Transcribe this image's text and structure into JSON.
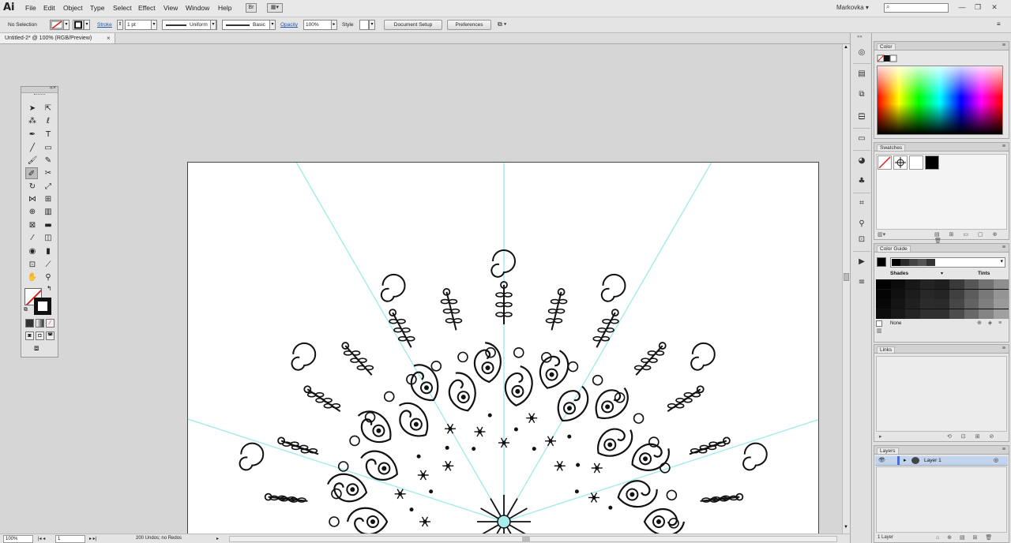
{
  "app": {
    "logo": "Ai"
  },
  "menu": [
    "File",
    "Edit",
    "Object",
    "Type",
    "Select",
    "Effect",
    "View",
    "Window",
    "Help"
  ],
  "workspace": "Markovka",
  "control_bar": {
    "selection": "No Selection",
    "stroke_label": "Stroke",
    "stroke_weight": "1 pt",
    "profile": "Uniform",
    "brush": "Basic",
    "opacity_label": "Opacity",
    "opacity_value": "100%",
    "style_label": "Style",
    "document_setup": "Document Setup",
    "preferences": "Preferences"
  },
  "document_tab": {
    "title": "Untitled-2* @ 100% (RGB/Preview)",
    "close": "×"
  },
  "status_bar": {
    "zoom": "100%",
    "artboard": "1",
    "status": "200 Undos; no Redos"
  },
  "panels": {
    "color": {
      "title": "Color"
    },
    "swatches": {
      "title": "Swatches"
    },
    "color_guide": {
      "title": "Color Guide",
      "shades": "Shades",
      "tints": "Tints",
      "none": "None"
    },
    "links": {
      "title": "Links"
    },
    "layers": {
      "title": "Layers",
      "layer_name": "Layer 1",
      "count": "1 Layer"
    }
  },
  "colors": {
    "guide_line": "#a8ecec",
    "ink": "#111111",
    "accent_link": "#2255aa",
    "none_slash": "#e02020"
  },
  "icons": [
    "selection-tool-icon",
    "direct-selection-tool-icon",
    "pen-tool-icon",
    "type-tool-icon",
    "hand-tool-icon",
    "zoom-tool-icon",
    "eye-icon",
    "search-icon"
  ]
}
